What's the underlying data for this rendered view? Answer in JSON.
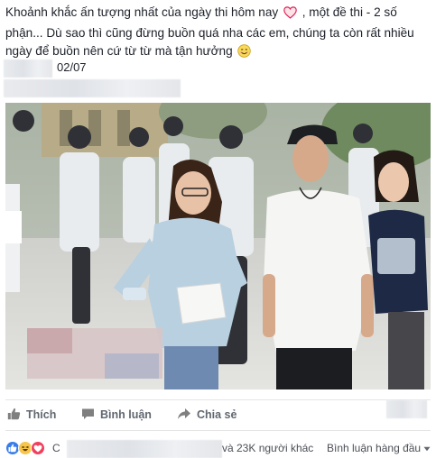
{
  "post": {
    "caption_part1": "Khoảnh khắc ấn tượng nhất của ngày thi hôm nay",
    "caption_part2": ", một đề thi - 2 số phận... Dù sao thì cũng đừng buồn quá nha các em, chúng ta còn rất nhiều ngày để buồn nên cứ từ từ mà tận hưởng",
    "caption_icons": [
      "heart-outline-icon",
      "smiling-face-icon"
    ],
    "date": "02/07"
  },
  "actions": {
    "like_label": "Thích",
    "comment_label": "Bình luận",
    "share_label": "Chia sẻ"
  },
  "footer": {
    "reaction_icons": [
      "like-icon",
      "haha-icon",
      "love-icon"
    ],
    "commenter_initial": "C",
    "reaction_count": "và 23K người khác",
    "sort_label": "Bình luận hàng đầu"
  },
  "colors": {
    "text": "#1d2129",
    "muted": "#606770",
    "like_blue": "#3b7de8",
    "love_red": "#f0405d",
    "haha_yellow": "#f7c64a"
  }
}
